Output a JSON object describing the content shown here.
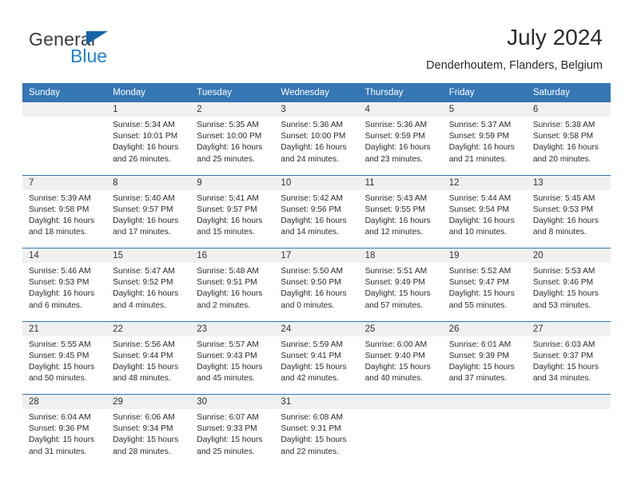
{
  "brand": {
    "name_part1": "General",
    "name_part2": "Blue",
    "logo_icon": "triangle-logo-icon"
  },
  "header": {
    "title": "July 2024",
    "subtitle": "Denderhoutem, Flanders, Belgium"
  },
  "theme": {
    "header_blue": "#3576b5",
    "date_band": "#f0f0f0",
    "brand_blue": "#2483c8",
    "logo_blue": "#1565a8"
  },
  "calendar": {
    "weekday_headers": [
      "Sunday",
      "Monday",
      "Tuesday",
      "Wednesday",
      "Thursday",
      "Friday",
      "Saturday"
    ],
    "weeks": [
      {
        "days": [
          {
            "date": "",
            "lines": []
          },
          {
            "date": "1",
            "lines": [
              "Sunrise: 5:34 AM",
              "Sunset: 10:01 PM",
              "Daylight: 16 hours",
              "and 26 minutes."
            ]
          },
          {
            "date": "2",
            "lines": [
              "Sunrise: 5:35 AM",
              "Sunset: 10:00 PM",
              "Daylight: 16 hours",
              "and 25 minutes."
            ]
          },
          {
            "date": "3",
            "lines": [
              "Sunrise: 5:36 AM",
              "Sunset: 10:00 PM",
              "Daylight: 16 hours",
              "and 24 minutes."
            ]
          },
          {
            "date": "4",
            "lines": [
              "Sunrise: 5:36 AM",
              "Sunset: 9:59 PM",
              "Daylight: 16 hours",
              "and 23 minutes."
            ]
          },
          {
            "date": "5",
            "lines": [
              "Sunrise: 5:37 AM",
              "Sunset: 9:59 PM",
              "Daylight: 16 hours",
              "and 21 minutes."
            ]
          },
          {
            "date": "6",
            "lines": [
              "Sunrise: 5:38 AM",
              "Sunset: 9:58 PM",
              "Daylight: 16 hours",
              "and 20 minutes."
            ]
          }
        ]
      },
      {
        "days": [
          {
            "date": "7",
            "lines": [
              "Sunrise: 5:39 AM",
              "Sunset: 9:58 PM",
              "Daylight: 16 hours",
              "and 18 minutes."
            ]
          },
          {
            "date": "8",
            "lines": [
              "Sunrise: 5:40 AM",
              "Sunset: 9:57 PM",
              "Daylight: 16 hours",
              "and 17 minutes."
            ]
          },
          {
            "date": "9",
            "lines": [
              "Sunrise: 5:41 AM",
              "Sunset: 9:57 PM",
              "Daylight: 16 hours",
              "and 15 minutes."
            ]
          },
          {
            "date": "10",
            "lines": [
              "Sunrise: 5:42 AM",
              "Sunset: 9:56 PM",
              "Daylight: 16 hours",
              "and 14 minutes."
            ]
          },
          {
            "date": "11",
            "lines": [
              "Sunrise: 5:43 AM",
              "Sunset: 9:55 PM",
              "Daylight: 16 hours",
              "and 12 minutes."
            ]
          },
          {
            "date": "12",
            "lines": [
              "Sunrise: 5:44 AM",
              "Sunset: 9:54 PM",
              "Daylight: 16 hours",
              "and 10 minutes."
            ]
          },
          {
            "date": "13",
            "lines": [
              "Sunrise: 5:45 AM",
              "Sunset: 9:53 PM",
              "Daylight: 16 hours",
              "and 8 minutes."
            ]
          }
        ]
      },
      {
        "days": [
          {
            "date": "14",
            "lines": [
              "Sunrise: 5:46 AM",
              "Sunset: 9:53 PM",
              "Daylight: 16 hours",
              "and 6 minutes."
            ]
          },
          {
            "date": "15",
            "lines": [
              "Sunrise: 5:47 AM",
              "Sunset: 9:52 PM",
              "Daylight: 16 hours",
              "and 4 minutes."
            ]
          },
          {
            "date": "16",
            "lines": [
              "Sunrise: 5:48 AM",
              "Sunset: 9:51 PM",
              "Daylight: 16 hours",
              "and 2 minutes."
            ]
          },
          {
            "date": "17",
            "lines": [
              "Sunrise: 5:50 AM",
              "Sunset: 9:50 PM",
              "Daylight: 16 hours",
              "and 0 minutes."
            ]
          },
          {
            "date": "18",
            "lines": [
              "Sunrise: 5:51 AM",
              "Sunset: 9:49 PM",
              "Daylight: 15 hours",
              "and 57 minutes."
            ]
          },
          {
            "date": "19",
            "lines": [
              "Sunrise: 5:52 AM",
              "Sunset: 9:47 PM",
              "Daylight: 15 hours",
              "and 55 minutes."
            ]
          },
          {
            "date": "20",
            "lines": [
              "Sunrise: 5:53 AM",
              "Sunset: 9:46 PM",
              "Daylight: 15 hours",
              "and 53 minutes."
            ]
          }
        ]
      },
      {
        "days": [
          {
            "date": "21",
            "lines": [
              "Sunrise: 5:55 AM",
              "Sunset: 9:45 PM",
              "Daylight: 15 hours",
              "and 50 minutes."
            ]
          },
          {
            "date": "22",
            "lines": [
              "Sunrise: 5:56 AM",
              "Sunset: 9:44 PM",
              "Daylight: 15 hours",
              "and 48 minutes."
            ]
          },
          {
            "date": "23",
            "lines": [
              "Sunrise: 5:57 AM",
              "Sunset: 9:43 PM",
              "Daylight: 15 hours",
              "and 45 minutes."
            ]
          },
          {
            "date": "24",
            "lines": [
              "Sunrise: 5:59 AM",
              "Sunset: 9:41 PM",
              "Daylight: 15 hours",
              "and 42 minutes."
            ]
          },
          {
            "date": "25",
            "lines": [
              "Sunrise: 6:00 AM",
              "Sunset: 9:40 PM",
              "Daylight: 15 hours",
              "and 40 minutes."
            ]
          },
          {
            "date": "26",
            "lines": [
              "Sunrise: 6:01 AM",
              "Sunset: 9:39 PM",
              "Daylight: 15 hours",
              "and 37 minutes."
            ]
          },
          {
            "date": "27",
            "lines": [
              "Sunrise: 6:03 AM",
              "Sunset: 9:37 PM",
              "Daylight: 15 hours",
              "and 34 minutes."
            ]
          }
        ]
      },
      {
        "days": [
          {
            "date": "28",
            "lines": [
              "Sunrise: 6:04 AM",
              "Sunset: 9:36 PM",
              "Daylight: 15 hours",
              "and 31 minutes."
            ]
          },
          {
            "date": "29",
            "lines": [
              "Sunrise: 6:06 AM",
              "Sunset: 9:34 PM",
              "Daylight: 15 hours",
              "and 28 minutes."
            ]
          },
          {
            "date": "30",
            "lines": [
              "Sunrise: 6:07 AM",
              "Sunset: 9:33 PM",
              "Daylight: 15 hours",
              "and 25 minutes."
            ]
          },
          {
            "date": "31",
            "lines": [
              "Sunrise: 6:08 AM",
              "Sunset: 9:31 PM",
              "Daylight: 15 hours",
              "and 22 minutes."
            ]
          },
          {
            "date": "",
            "lines": []
          },
          {
            "date": "",
            "lines": []
          },
          {
            "date": "",
            "lines": []
          }
        ]
      }
    ]
  }
}
